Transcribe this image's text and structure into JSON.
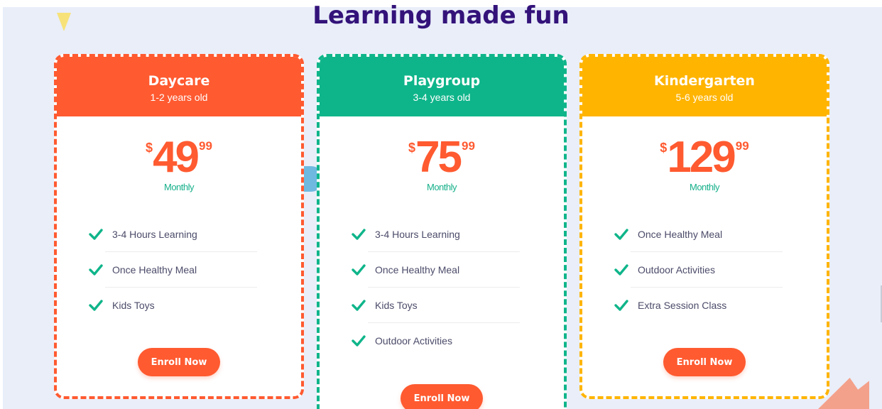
{
  "section": {
    "title": "Learning made fun"
  },
  "plans": [
    {
      "name": "Daycare",
      "age": "1-2 years old",
      "color": "#ff5a30",
      "currency": "$",
      "amount": "49",
      "cents": "99",
      "billing": "Monthly",
      "features": [
        "3-4 Hours Learning",
        "Once Healthy Meal",
        "Kids Toys"
      ],
      "cta": "Enroll Now"
    },
    {
      "name": "Playgroup",
      "age": "3-4 years old",
      "color": "#0fb58a",
      "currency": "$",
      "amount": "75",
      "cents": "99",
      "billing": "Monthly",
      "features": [
        "3-4 Hours Learning",
        "Once Healthy Meal",
        "Kids Toys",
        "Outdoor Activities"
      ],
      "cta": "Enroll Now"
    },
    {
      "name": "Kindergarten",
      "age": "5-6 years old",
      "color": "#ffb400",
      "currency": "$",
      "amount": "129",
      "cents": "99",
      "billing": "Monthly",
      "features": [
        "Once Healthy Meal",
        "Outdoor Activities",
        "Extra Session Class"
      ],
      "cta": "Enroll Now"
    }
  ],
  "icons": {
    "feature": "check-icon"
  },
  "colors": {
    "check": "#0fb58a",
    "title": "#33137a",
    "price": "#ff5a30"
  }
}
